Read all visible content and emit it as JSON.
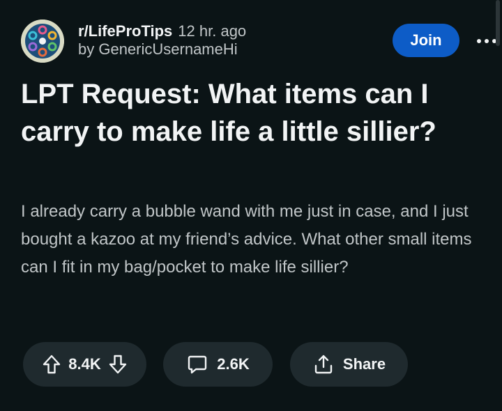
{
  "post": {
    "subreddit": "r/LifeProTips",
    "time": "12 hr. ago",
    "author": "by GenericUsernameHi",
    "title": "LPT Request: What items can I carry to make life a little sillier?",
    "body": "I already carry a bubble wand with me just in case, and I just bought a kazoo at my friend’s advice. What other small items can I fit in my bag/pocket to make life sillier?"
  },
  "header": {
    "join_label": "Join",
    "avatar_icon": "lifeprotips-community-icon",
    "more_icon": "more-options-icon"
  },
  "actions": {
    "vote_count": "8.4K",
    "comment_count": "2.6K",
    "share_label": "Share",
    "upvote_icon": "upvote-arrow-icon",
    "downvote_icon": "downvote-arrow-icon",
    "comment_icon": "comment-bubble-icon",
    "share_icon": "share-icon"
  },
  "colors": {
    "background": "#0b1416",
    "join_button": "#0d5cc7",
    "pill_background": "#1f2a2e",
    "primary_text": "#f2f4f5",
    "secondary_text": "#c1c6c8"
  }
}
